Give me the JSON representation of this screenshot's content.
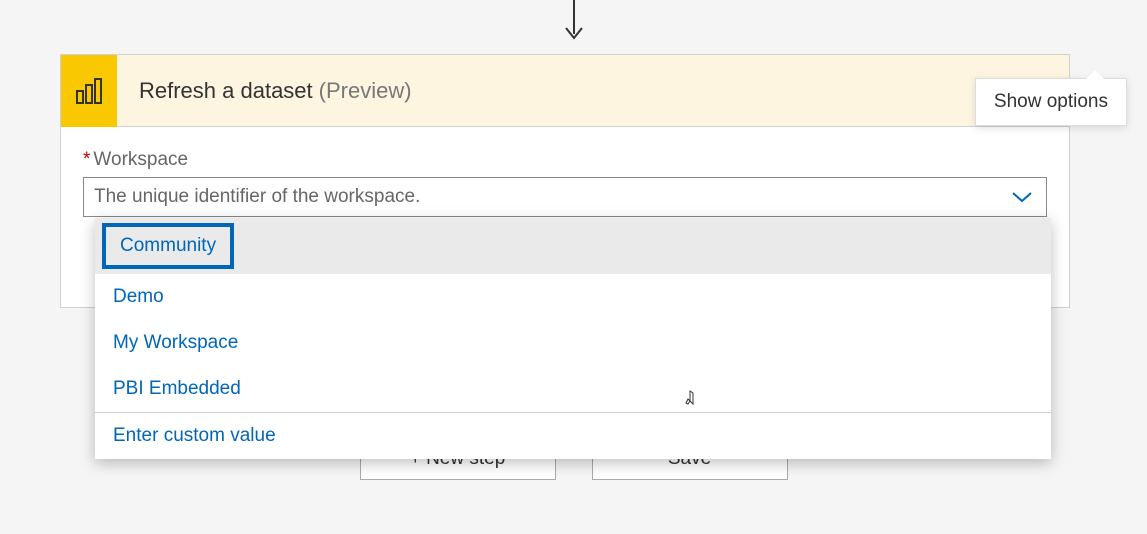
{
  "card": {
    "title": "Refresh a dataset",
    "title_suffix": "(Preview)",
    "more_tooltip": "Show options"
  },
  "field": {
    "required_marker": "*",
    "label": "Workspace",
    "placeholder": "The unique identifier of the workspace."
  },
  "dropdown": {
    "items": [
      "Community",
      "Demo",
      "My Workspace",
      "PBI Embedded"
    ],
    "custom": "Enter custom value"
  },
  "buttons": {
    "new_step": "+ New step",
    "save": "Save"
  }
}
